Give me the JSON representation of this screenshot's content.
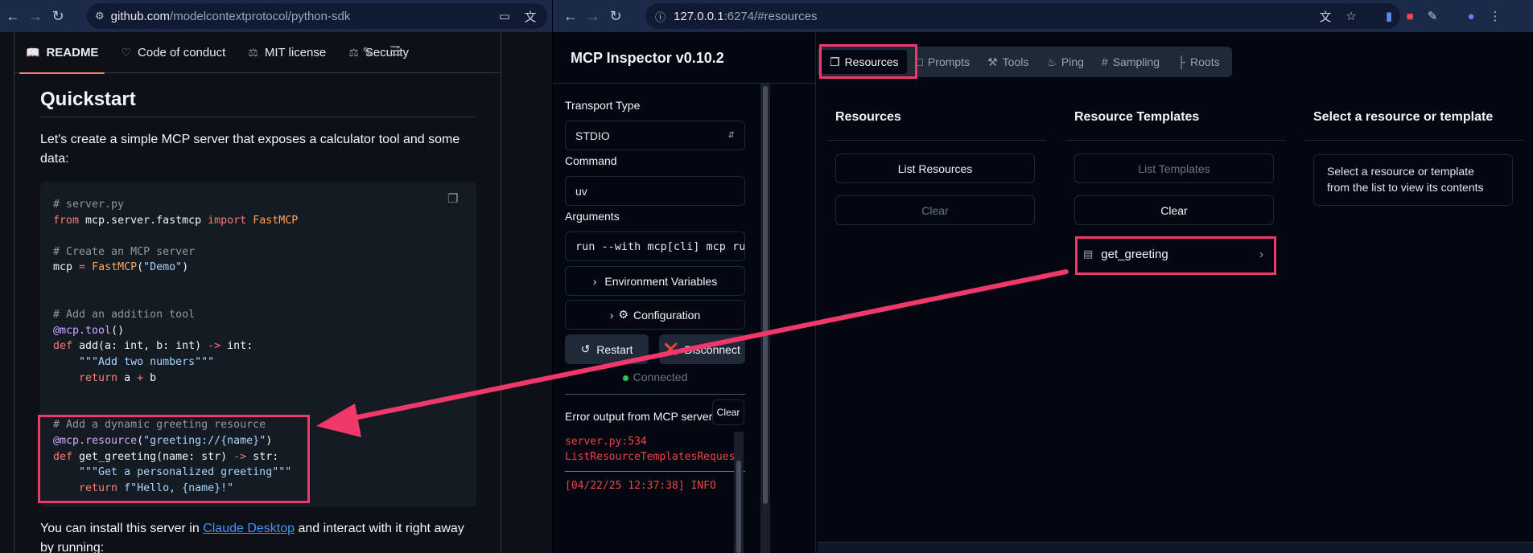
{
  "left_browser": {
    "url_host": "github.com",
    "url_path": "/modelcontextprotocol/python-sdk"
  },
  "github": {
    "tabs": [
      {
        "label": "README",
        "icon": "book-icon"
      },
      {
        "label": "Code of conduct",
        "icon": "heart-icon"
      },
      {
        "label": "MIT license",
        "icon": "scale-icon"
      },
      {
        "label": "Security",
        "icon": "scale-icon"
      }
    ],
    "heading": "Quickstart",
    "intro": "Let's create a simple MCP server that exposes a calculator tool and some data:",
    "code_lines": [
      "# server.py",
      "from mcp.server.fastmcp import FastMCP",
      "",
      "# Create an MCP server",
      "mcp = FastMCP(\"Demo\")",
      "",
      "",
      "# Add an addition tool",
      "@mcp.tool()",
      "def add(a: int, b: int) -> int:",
      "    \"\"\"Add two numbers\"\"\"",
      "    return a + b",
      "",
      "",
      "# Add a dynamic greeting resource",
      "@mcp.resource(\"greeting://{name}\")",
      "def get_greeting(name: str) -> str:",
      "    \"\"\"Get a personalized greeting\"\"\"",
      "    return f\"Hello, {name}!\""
    ],
    "outro_before": "You can install this server in ",
    "outro_link": "Claude Desktop",
    "outro_after": " and interact with it right away by running:"
  },
  "right_browser": {
    "url_host": "127.0.0.1",
    "url_path": ":6274/#resources"
  },
  "inspector": {
    "title": "MCP Inspector v0.10.2",
    "transport_label": "Transport Type",
    "transport_value": "STDIO",
    "command_label": "Command",
    "command_value": "uv",
    "arguments_label": "Arguments",
    "arguments_value": "run --with mcp[cli] mcp run /U",
    "env_button": "Environment Variables",
    "config_button": "Configuration",
    "restart_button": "Restart",
    "disconnect_button": "Disconnect",
    "status": "Connected",
    "status_color": "#22c55e",
    "error_title": "Error output from MCP server",
    "error_clear": "Clear",
    "error_lines": [
      "server.py:534",
      "ListResourceTemplatesRequest",
      "[04/22/25 12:37:38] INFO"
    ],
    "tabs": [
      {
        "label": "Resources",
        "icon": "copy-icon",
        "active": true
      },
      {
        "label": "Prompts",
        "icon": "message-icon",
        "active": false
      },
      {
        "label": "Tools",
        "icon": "hammer-icon",
        "active": false
      },
      {
        "label": "Ping",
        "icon": "bell-icon",
        "active": false
      },
      {
        "label": "Sampling",
        "icon": "hash-icon",
        "active": false
      },
      {
        "label": "Roots",
        "icon": "folder-tree-icon",
        "active": false
      }
    ],
    "resources_title": "Resources",
    "list_resources": "List Resources",
    "resources_clear": "Clear",
    "templates_title": "Resource Templates",
    "list_templates": "List Templates",
    "templates_clear": "Clear",
    "template_item": "get_greeting",
    "detail_title": "Select a resource or template",
    "detail_text": "Select a resource or template from the list to view its contents"
  },
  "annotation_color": "#f0386b"
}
